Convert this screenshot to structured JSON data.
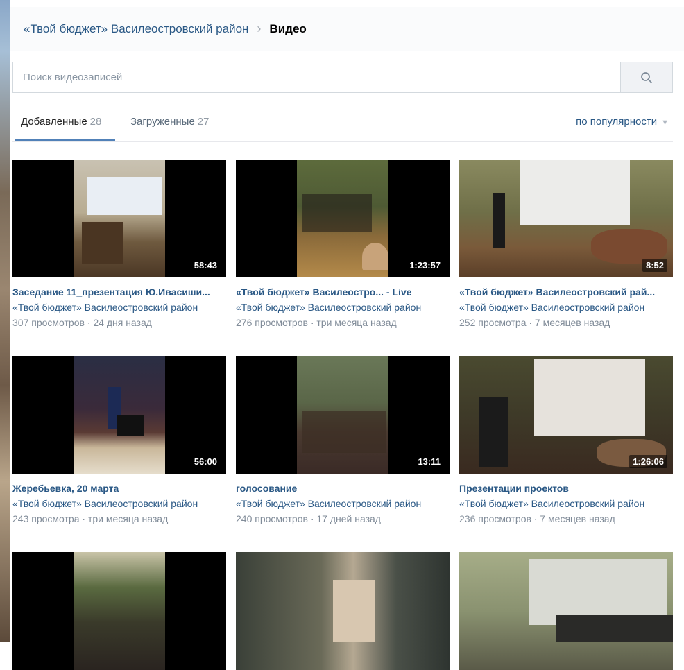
{
  "breadcrumb": {
    "group": "«Твой бюджет» Василеостровский район",
    "separator": "›",
    "current": "Видео"
  },
  "search": {
    "placeholder": "Поиск видеозаписей",
    "icon": "search-icon"
  },
  "tabs": [
    {
      "label": "Добавленные",
      "count": "28",
      "active": true
    },
    {
      "label": "Загруженные",
      "count": "27",
      "active": false
    }
  ],
  "sort": {
    "label": "по популярности",
    "icon": "caret-down-icon"
  },
  "videos": [
    {
      "title": "Заседание 11_презентация Ю.Ивасиши...",
      "author": "«Твой бюджет» Василеостровский район",
      "meta": "307 просмотров · 24 дня назад",
      "duration": "58:43"
    },
    {
      "title": "«Твой бюджет» Василеостро... - Live",
      "author": "«Твой бюджет» Василеостровский район",
      "meta": "276 просмотров · три месяца назад",
      "duration": "1:23:57"
    },
    {
      "title": "«Твой бюджет» Василеостровский рай...",
      "author": "«Твой бюджет» Василеостровский район",
      "meta": "252 просмотра · 7 месяцев назад",
      "duration": "8:52"
    },
    {
      "title": "Жеребьевка, 20 марта",
      "author": "«Твой бюджет» Василеостровский район",
      "meta": "243 просмотра · три месяца назад",
      "duration": "56:00"
    },
    {
      "title": "голосование",
      "author": "«Твой бюджет» Василеостровский район",
      "meta": "240 просмотров · 17 дней назад",
      "duration": "13:11"
    },
    {
      "title": "Презентации проектов",
      "author": "«Твой бюджет» Василеостровский район",
      "meta": "236 просмотров · 7 месяцев назад",
      "duration": "1:26:06"
    },
    {
      "title": "",
      "author": "",
      "meta": "",
      "duration": ""
    },
    {
      "title": "",
      "author": "",
      "meta": "",
      "duration": ""
    },
    {
      "title": "",
      "author": "",
      "meta": "",
      "duration": ""
    }
  ],
  "colors": {
    "link": "#2a5885",
    "accent": "#5181b8",
    "muted": "#818c99"
  }
}
